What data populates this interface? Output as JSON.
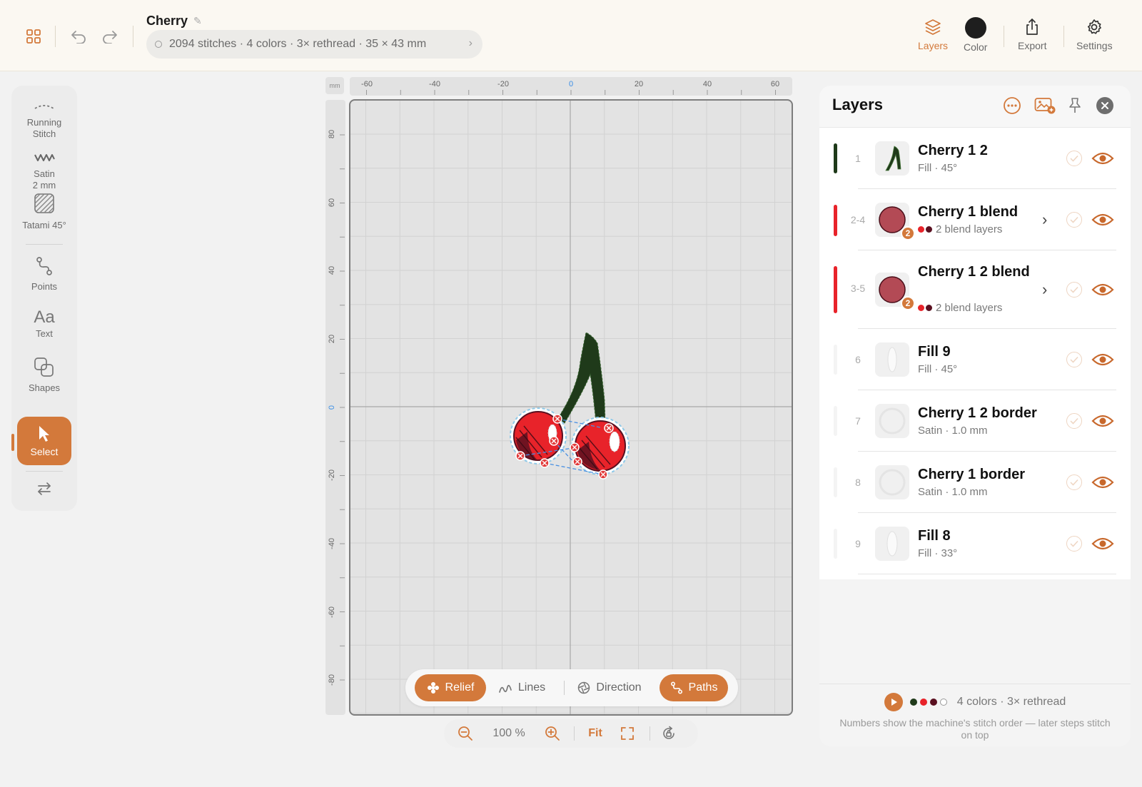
{
  "header": {
    "title": "Cherry",
    "info": "2094 stitches · 4 colors · 3× rethread · 35 × 43 mm",
    "buttons": {
      "layers": "Layers",
      "color": "Color",
      "export": "Export",
      "settings": "Settings"
    }
  },
  "tools": {
    "running": "Running\nStitch",
    "satin": "Satin\n2 mm",
    "tatami": "Tatami 45°",
    "points": "Points",
    "text_glyph": "Aa",
    "text": "Text",
    "shapes": "Shapes",
    "select": "Select"
  },
  "ruler": {
    "unit": "mm",
    "x_ticks": [
      "-60",
      "-40",
      "-20",
      "0",
      "20",
      "40",
      "60"
    ],
    "y_ticks": [
      "80",
      "60",
      "40",
      "20",
      "0",
      "-20",
      "-40",
      "-60",
      "-80"
    ]
  },
  "view_toggles": {
    "relief": "Relief",
    "lines": "Lines",
    "direction": "Direction",
    "paths": "Paths"
  },
  "zoom": {
    "level": "100 %",
    "fit": "Fit"
  },
  "panel": {
    "title": "Layers",
    "layers": [
      {
        "index": "1",
        "name": "Cherry 1 2",
        "detail": "Fill · 45°",
        "bar_color": "#1f3a1a",
        "visible": true
      },
      {
        "index": "2-4",
        "name": "Cherry 1 blend",
        "detail": "2 blend layers",
        "badge": "2",
        "bar_color": "#e8232a",
        "has_children": true,
        "visible": true
      },
      {
        "index": "3-5",
        "name": "Cherry 1 2 blend",
        "detail": "2 blend layers",
        "badge": "2",
        "bar_color": "#e8232a",
        "has_children": true,
        "visible": true
      },
      {
        "index": "6",
        "name": "Fill 9",
        "detail": "Fill · 45°",
        "visible": true
      },
      {
        "index": "7",
        "name": "Cherry 1 2 border",
        "detail": "Satin · 1.0 mm",
        "visible": true
      },
      {
        "index": "8",
        "name": "Cherry 1 border",
        "detail": "Satin · 1.0 mm",
        "visible": true
      },
      {
        "index": "9",
        "name": "Fill 8",
        "detail": "Fill · 33°",
        "visible": true
      }
    ],
    "footer": {
      "summary": "4 colors · 3× rethread",
      "note": "Numbers show the machine's stitch order — later steps stitch on top",
      "thread_colors": [
        "#1f3a1a",
        "#e8232a",
        "#5a1020",
        "#ffffff"
      ]
    }
  },
  "colors": {
    "accent": "#d3793b",
    "stem": "#1f3a1a",
    "cherry_red": "#e8232a",
    "cherry_dark": "#5a1020"
  }
}
